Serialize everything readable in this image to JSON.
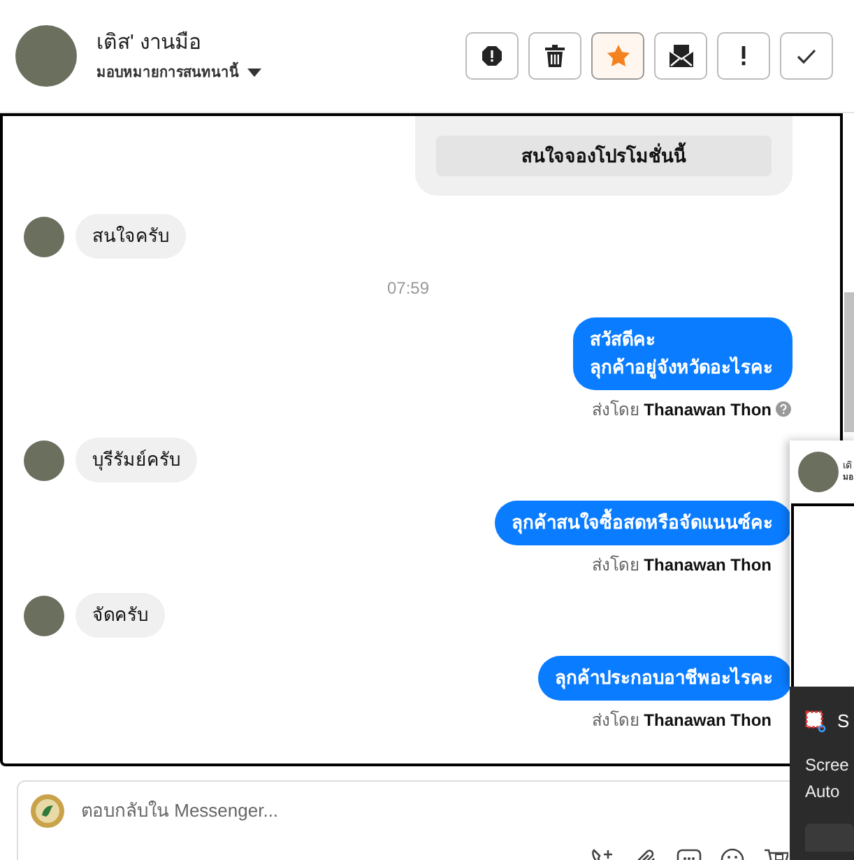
{
  "header": {
    "name": "เติส' งานมือ",
    "assign_label": "มอบหมายการสนทนานี้",
    "actions": [
      {
        "kind": "spam",
        "selected": false
      },
      {
        "kind": "delete",
        "selected": false
      },
      {
        "kind": "star",
        "selected": true
      },
      {
        "kind": "unread",
        "selected": false
      },
      {
        "kind": "important",
        "selected": false
      },
      {
        "kind": "done",
        "selected": false
      }
    ]
  },
  "messages": [
    {
      "kind": "card",
      "button": "สนใจจองโปรโมชั่นนี้"
    },
    {
      "kind": "incoming",
      "text": "สนใจครับ"
    },
    {
      "kind": "time",
      "text": "07:59"
    },
    {
      "kind": "outgoing",
      "text": "สวัสดีคะ\nลุกค้าอยู่จังหวัดอะไรคะ",
      "sent_by": "ส่งโดย",
      "sender": "Thanawan Thon",
      "help": true
    },
    {
      "kind": "incoming",
      "text": "บุรีรัมย์ครับ"
    },
    {
      "kind": "outgoing",
      "text": "ลุกค้าสนใจซื้อสดหรือจัดแนนซ์คะ",
      "sent_by": "ส่งโดย",
      "sender": "Thanawan Thon",
      "help": false
    },
    {
      "kind": "incoming",
      "text": "จัดครับ"
    },
    {
      "kind": "outgoing",
      "text": "ลุกค้าประกอบอาชีพอะไรคะ",
      "sent_by": "ส่งโดย",
      "sender": "Thanawan Thon",
      "help": false
    }
  ],
  "composer": {
    "placeholder": "ตอบกลับใน Messenger...",
    "tools": [
      {
        "kind": "call"
      },
      {
        "kind": "attach"
      },
      {
        "kind": "reply"
      },
      {
        "kind": "emoji"
      },
      {
        "kind": "cart"
      }
    ]
  },
  "popup": {
    "name": "เดิ",
    "subtitle": "มอ"
  },
  "toast": {
    "app": "S",
    "lines": [
      "Scree",
      "Auto"
    ]
  }
}
